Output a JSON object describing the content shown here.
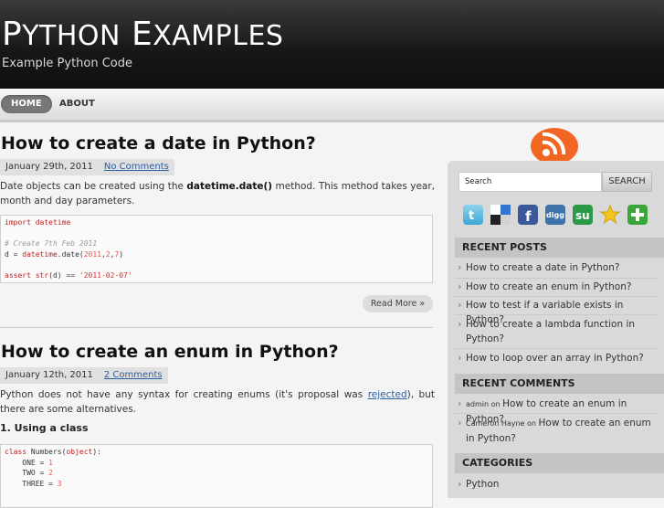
{
  "site": {
    "title_first_initial": "P",
    "title_first_rest": "YTHON",
    "title_second_initial": "E",
    "title_second_rest": "XAMPLES",
    "description": "Example Python Code"
  },
  "nav": {
    "home": "HOME",
    "about": "ABOUT"
  },
  "posts": [
    {
      "title": "How to create a date in Python?",
      "date": "January 29th, 2011",
      "comments": "No Comments",
      "para_before": "Date objects can be created using the ",
      "para_bold": "datetime.date()",
      "para_after": " method. This method takes year, month and day parameters.",
      "read_more": "Read More »"
    },
    {
      "title": "How to create an enum in Python?",
      "date": "January 12th, 2011",
      "comments": "2 Comments",
      "para_before": "Python does not have any syntax for creating enums (it's proposal was ",
      "para_link": "rejected",
      "para_after": "), but there are some alternatives.",
      "subheading": "1. Using a class"
    }
  ],
  "code1": {
    "l1_kw": "import",
    "l1_rest": " datetime",
    "l3_comment": "# Create 7th Feb 2011",
    "l4_a": "d = ",
    "l4_b": "datetime",
    "l4_c": ".date(",
    "l4_n1": "2011",
    "l4_c2": ",",
    "l4_n2": "2",
    "l4_c3": ",",
    "l4_n3": "7",
    "l4_c4": ")",
    "l6_kw": "assert",
    "l6_b": " str",
    "l6_c": "(d) == ",
    "l6_str": "'2011-02-07'"
  },
  "code2": {
    "l1_kw": "class",
    "l1_b": " Numbers(",
    "l1_c": "object",
    "l1_d": "):",
    "l2_a": "    ONE = ",
    "l2_n": "1",
    "l3_a": "    TWO = ",
    "l3_n": "2",
    "l4_a": "    THREE = ",
    "l4_n": "3"
  },
  "sidebar": {
    "search_value": "Search",
    "search_button": "SEARCH",
    "social_icons": [
      "twitter-icon",
      "delicious-icon",
      "facebook-icon",
      "digg-icon",
      "stumbleupon-icon",
      "favorite-star-icon",
      "add-plus-icon"
    ],
    "recent_posts_heading": "RECENT POSTS",
    "recent_posts": [
      "How to create a date in Python?",
      "How to create an enum in Python?",
      "How to test if a variable exists in Python?",
      "How to create a lambda function in Python?",
      "How to loop over an array in Python?"
    ],
    "recent_comments_heading": "RECENT COMMENTS",
    "recent_comments": [
      {
        "author": "admin",
        "on": " on ",
        "post": "How to create an enum in Python?"
      },
      {
        "author": "Cameron Hayne",
        "on": " on ",
        "post": "How to create an enum in Python?"
      }
    ],
    "categories_heading": "CATEGORIES",
    "categories": [
      "Python"
    ]
  },
  "colors": {
    "header": "#161616",
    "accent_link": "#2a5fa0",
    "rss": "#f26522"
  }
}
